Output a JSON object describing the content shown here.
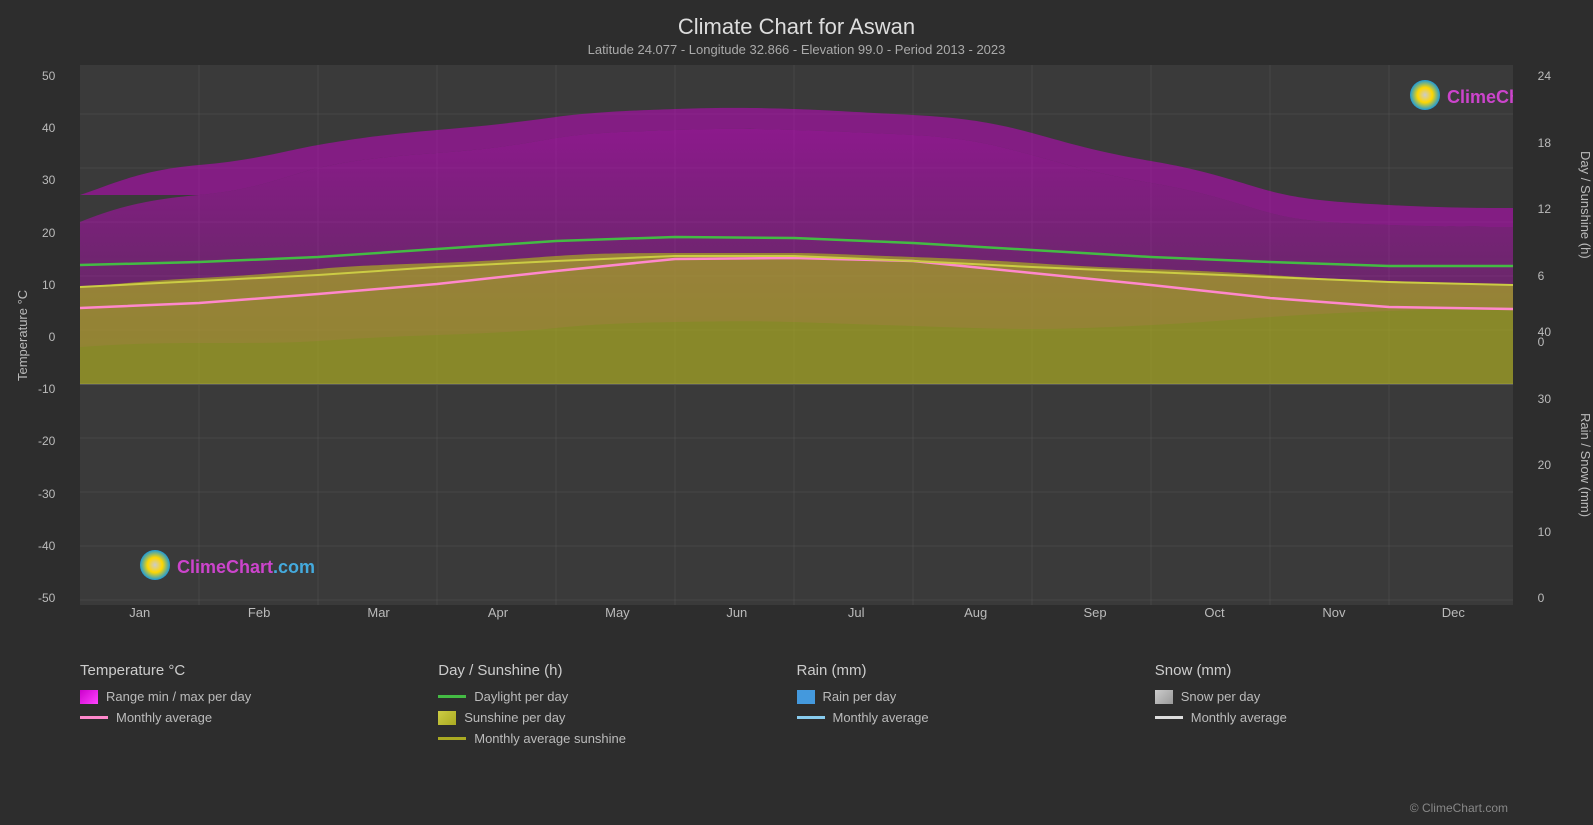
{
  "title": "Climate Chart for Aswan",
  "subtitle": "Latitude 24.077 - Longitude 32.866 - Elevation 99.0 - Period 2013 - 2023",
  "chart": {
    "y_left_label": "Temperature °C",
    "y_right_label_top": "Day / Sunshine (h)",
    "y_right_label_bottom": "Rain / Snow (mm)",
    "y_left_ticks": [
      "50",
      "40",
      "30",
      "20",
      "10",
      "0",
      "-10",
      "-20",
      "-30",
      "-40",
      "-50"
    ],
    "y_right_ticks_top": [
      "24",
      "18",
      "12",
      "6",
      "0"
    ],
    "y_right_ticks_bottom": [
      "0",
      "10",
      "20",
      "30",
      "40"
    ],
    "x_labels": [
      "Jan",
      "Feb",
      "Mar",
      "Apr",
      "May",
      "Jun",
      "Jul",
      "Aug",
      "Sep",
      "Oct",
      "Nov",
      "Dec"
    ]
  },
  "legend": {
    "col1": {
      "title": "Temperature °C",
      "items": [
        {
          "type": "swatch",
          "color": "#cc44cc",
          "label": "Range min / max per day"
        },
        {
          "type": "line",
          "color": "#ff88cc",
          "label": "Monthly average"
        }
      ]
    },
    "col2": {
      "title": "Day / Sunshine (h)",
      "items": [
        {
          "type": "line",
          "color": "#44bb44",
          "label": "Daylight per day"
        },
        {
          "type": "swatch",
          "color": "#cccc44",
          "label": "Sunshine per day"
        },
        {
          "type": "line",
          "color": "#aaaa22",
          "label": "Monthly average sunshine"
        }
      ]
    },
    "col3": {
      "title": "Rain (mm)",
      "items": [
        {
          "type": "swatch",
          "color": "#4499dd",
          "label": "Rain per day"
        },
        {
          "type": "line",
          "color": "#88ccee",
          "label": "Monthly average"
        }
      ]
    },
    "col4": {
      "title": "Snow (mm)",
      "items": [
        {
          "type": "swatch",
          "color": "#bbbbbb",
          "label": "Snow per day"
        },
        {
          "type": "line",
          "color": "#dddddd",
          "label": "Monthly average"
        }
      ]
    }
  },
  "watermark": "© ClimeChart.com",
  "logo_text1": "ClimeChart",
  "logo_text2": ".com"
}
